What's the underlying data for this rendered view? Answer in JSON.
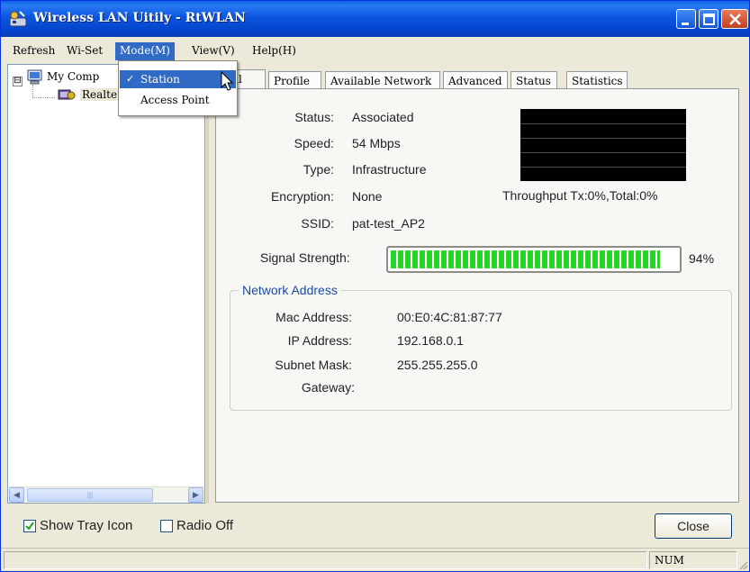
{
  "window": {
    "title": "Wireless LAN Uitily - RtWLAN",
    "buttons": {
      "minimize": "minimize",
      "maximize": "maximize",
      "close": "close"
    }
  },
  "menubar": {
    "items": [
      "Refresh",
      "Wi-Set",
      "Mode(M)",
      "View(V)",
      "Help(H)"
    ],
    "active": "Mode(M)"
  },
  "mode_menu": {
    "items": [
      {
        "label": "Station",
        "checked": true,
        "highlighted": true
      },
      {
        "label": "Access Point",
        "checked": false,
        "highlighted": false
      }
    ],
    "check_glyph": "✓"
  },
  "tree": {
    "root": "My Comp",
    "child": "Realte",
    "expander": "⊟"
  },
  "tabs": [
    "eral",
    "Profile",
    "Available Network",
    "Advanced",
    "Status",
    "Statistics"
  ],
  "active_tab": "eral",
  "general": {
    "status_label": "Status:",
    "status_value": "Associated",
    "speed_label": "Speed:",
    "speed_value": "54 Mbps",
    "type_label": "Type:",
    "type_value": "Infrastructure",
    "encryption_label": "Encryption:",
    "encryption_value": "None",
    "ssid_label": "SSID:",
    "ssid_value": "pat-test_AP2",
    "throughput_caption": "Throughput Tx:0%,Total:0%",
    "signal_label": "Signal Strength:",
    "signal_text": "94%",
    "signal_level": 0.94
  },
  "network_address": {
    "legend": "Network Address",
    "mac_label": "Mac Address:",
    "mac_value": "00:E0:4C:81:87:77",
    "ip_label": "IP Address:",
    "ip_value": "192.168.0.1",
    "subnet_label": "Subnet Mask:",
    "subnet_value": "255.255.255.0",
    "gateway_label": "Gateway:",
    "gateway_value": ""
  },
  "footer": {
    "show_tray_icon": {
      "label": "Show Tray Icon",
      "checked": true
    },
    "radio_off": {
      "label": "Radio Off",
      "checked": false
    },
    "close_label": "Close"
  },
  "statusbar": {
    "num": "NUM"
  },
  "colors": {
    "titlebar": "#0b55e0",
    "selection": "#316ac5",
    "signal": "#27d427",
    "legend": "#1b4ca8"
  }
}
